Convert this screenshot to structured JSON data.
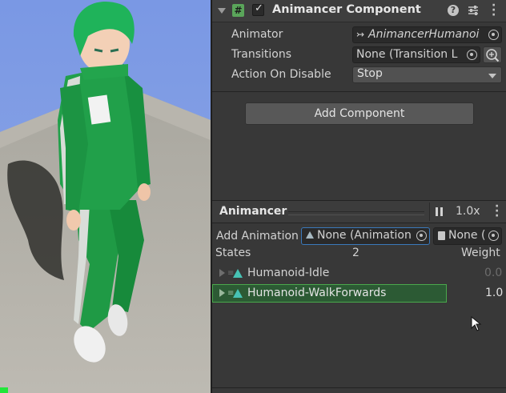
{
  "component": {
    "title": "Animancer Component",
    "enabled": true,
    "fields": [
      {
        "label": "Animator",
        "value": "AnimancerHumanoi"
      },
      {
        "label": "Transitions",
        "value": "None (Transition L"
      },
      {
        "label": "Action On Disable",
        "value": "Stop"
      }
    ],
    "add_component_label": "Add Component"
  },
  "animancer": {
    "title": "Animancer",
    "speed": "1.0x",
    "add_animation_label": "Add Animation",
    "add_animation_field": "None (Animation",
    "add_transition_field": "None (",
    "states_label": "States",
    "states_count": "2",
    "weight_label": "Weight",
    "states": [
      {
        "name": "Humanoid-Idle",
        "weight": "0.0",
        "selected": false
      },
      {
        "name": "Humanoid-WalkForwards",
        "weight": "1.0",
        "selected": true
      }
    ]
  },
  "colors": {
    "accent_teal": "#47c2b4",
    "selection_green": "#2c5a34",
    "field_focus_blue": "#3a79bb"
  }
}
